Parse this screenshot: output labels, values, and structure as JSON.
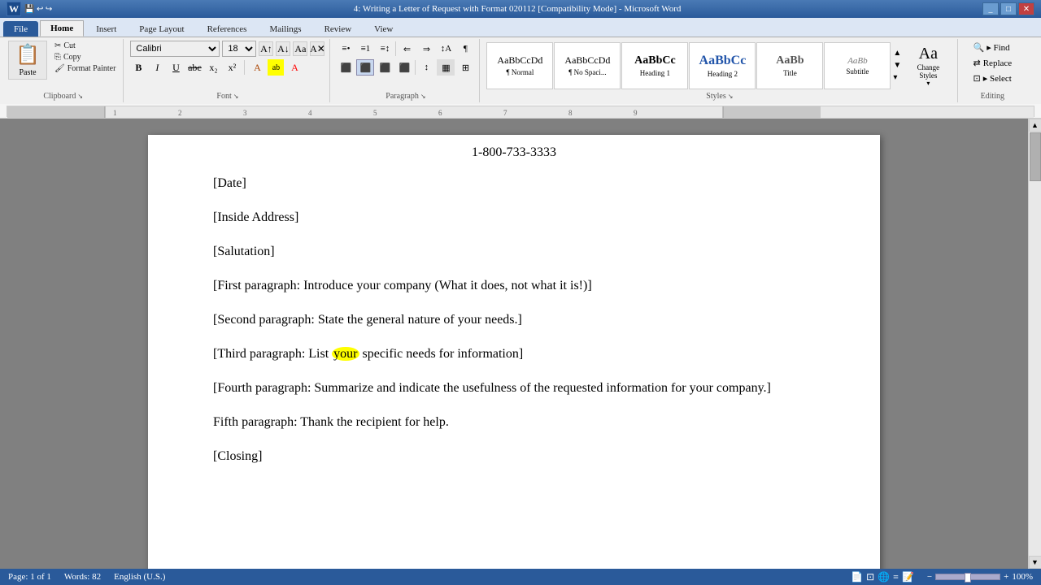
{
  "titleBar": {
    "title": "4: Writing a Letter of Request with Format 020112 [Compatibility Mode] - Microsoft Word",
    "buttons": [
      "_",
      "□",
      "✕"
    ]
  },
  "ribbonTabs": [
    "File",
    "Home",
    "Insert",
    "Page Layout",
    "References",
    "Mailings",
    "Review",
    "View"
  ],
  "activeTab": "Home",
  "clipboard": {
    "paste_label": "Paste",
    "cut_label": "Cut",
    "copy_label": "Copy",
    "format_painter_label": "Format Painter",
    "group_label": "Clipboard"
  },
  "font": {
    "current_font": "Calibri",
    "current_size": "18",
    "group_label": "Font",
    "bold": "B",
    "italic": "I",
    "underline": "U",
    "strikethrough": "abc",
    "subscript": "x₂",
    "superscript": "x²"
  },
  "paragraph": {
    "group_label": "Paragraph"
  },
  "styles": {
    "group_label": "Styles",
    "items": [
      {
        "name": "Normal",
        "label": "¶ Normal",
        "preview": "AaBbCcDd"
      },
      {
        "name": "No Spacing",
        "label": "¶ No Spaci...",
        "preview": "AaBbCcDd"
      },
      {
        "name": "Heading 1",
        "label": "Heading 1",
        "preview": "AaBbCc"
      },
      {
        "name": "Heading 2",
        "label": "Heading 2",
        "preview": "AaBbCc"
      },
      {
        "name": "Title",
        "label": "Title",
        "preview": "AaBb"
      },
      {
        "name": "Subtitle",
        "label": "Subtitle",
        "preview": "AaBb"
      }
    ],
    "change_styles_label": "Change\nStyles"
  },
  "editing": {
    "group_label": "Editing",
    "find_label": "▸ Find",
    "replace_label": "Replace",
    "select_label": "▸ Select"
  },
  "document": {
    "phone": "1-800-733-3333",
    "lines": [
      {
        "id": "date",
        "text": "[Date]"
      },
      {
        "id": "address",
        "text": "[Inside Address]"
      },
      {
        "id": "salutation",
        "text": "[Salutation]"
      },
      {
        "id": "para1",
        "text": "[First paragraph: Introduce your company (What it does, not what it is!)]"
      },
      {
        "id": "para2",
        "text": "[Second paragraph: State the general nature of your needs.]"
      },
      {
        "id": "para3",
        "text": "[Third paragraph: List your specific needs for information]",
        "highlighted": "your"
      },
      {
        "id": "para4",
        "text": "[Fourth paragraph: Summarize and indicate the usefulness of the requested information for your company.]"
      },
      {
        "id": "para5",
        "text": "Fifth paragraph: Thank the recipient for help."
      },
      {
        "id": "closing",
        "text": "[Closing]"
      }
    ]
  },
  "statusBar": {
    "page": "Page: 1 of 1",
    "words": "Words: 82",
    "language": "English (U.S.)"
  }
}
